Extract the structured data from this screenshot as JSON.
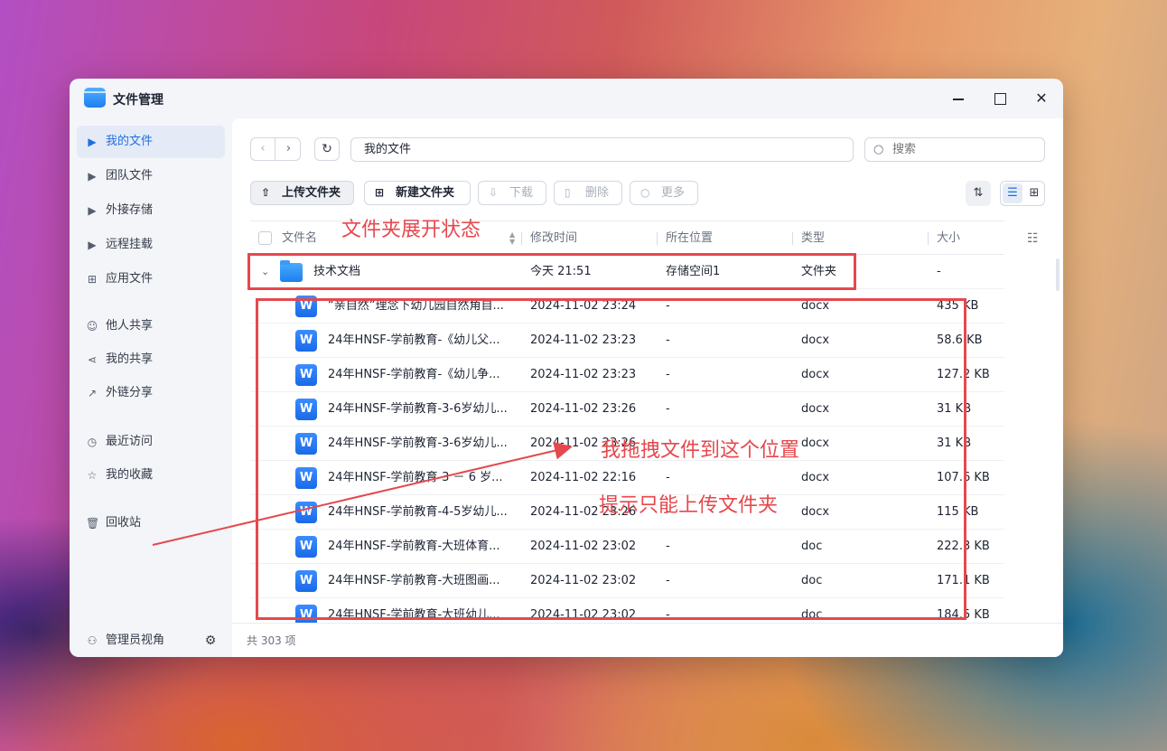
{
  "window": {
    "title": "文件管理"
  },
  "sidebar": {
    "items": [
      {
        "label": "我的文件",
        "icon": "caret-right-icon",
        "active": true
      },
      {
        "label": "团队文件",
        "icon": "caret-right-icon"
      },
      {
        "label": "外接存储",
        "icon": "caret-right-icon"
      },
      {
        "label": "远程挂载",
        "icon": "caret-right-icon"
      },
      {
        "label": "应用文件",
        "icon": "apps-icon"
      },
      {
        "label": "他人共享",
        "icon": "users-icon"
      },
      {
        "label": "我的共享",
        "icon": "share-icon"
      },
      {
        "label": "外链分享",
        "icon": "external-link-icon"
      },
      {
        "label": "最近访问",
        "icon": "clock-icon"
      },
      {
        "label": "我的收藏",
        "icon": "star-icon"
      },
      {
        "label": "回收站",
        "icon": "trash-icon"
      }
    ],
    "footer_label": "管理员视角"
  },
  "toolbar": {
    "path": "我的文件",
    "search_placeholder": "搜索",
    "upload_folder": "上传文件夹",
    "new_folder": "新建文件夹",
    "download": "下载",
    "delete": "删除",
    "more": "更多"
  },
  "table": {
    "headers": {
      "name": "文件名",
      "time": "修改时间",
      "location": "所在位置",
      "type": "类型",
      "size": "大小"
    },
    "folder": {
      "name": "技术文档",
      "time": "今天 21:51",
      "location": "存储空间1",
      "type": "文件夹",
      "size": "-"
    },
    "rows": [
      {
        "name": "“亲自然”理念下幼儿园自然角自...",
        "time": "2024-11-02 23:24",
        "location": "-",
        "type": "docx",
        "size": "435 KB"
      },
      {
        "name": "24年HNSF-学前教育-《幼儿父...",
        "time": "2024-11-02 23:23",
        "location": "-",
        "type": "docx",
        "size": "58.6 KB"
      },
      {
        "name": "24年HNSF-学前教育-《幼儿争...",
        "time": "2024-11-02 23:23",
        "location": "-",
        "type": "docx",
        "size": "127.2 KB"
      },
      {
        "name": "24年HNSF-学前教育-3-6岁幼儿...",
        "time": "2024-11-02 23:26",
        "location": "-",
        "type": "docx",
        "size": "31 KB"
      },
      {
        "name": "24年HNSF-学前教育-3-6岁幼儿...",
        "time": "2024-11-02 23:26",
        "location": "-",
        "type": "docx",
        "size": "31 KB"
      },
      {
        "name": "24年HNSF-学前教育-3 － 6 岁...",
        "time": "2024-11-02 22:16",
        "location": "-",
        "type": "docx",
        "size": "107.6 KB"
      },
      {
        "name": "24年HNSF-学前教育-4-5岁幼儿...",
        "time": "2024-11-02 23:26",
        "location": "-",
        "type": "docx",
        "size": "115 KB"
      },
      {
        "name": "24年HNSF-学前教育-大班体育...",
        "time": "2024-11-02 23:02",
        "location": "-",
        "type": "doc",
        "size": "222.3 KB"
      },
      {
        "name": "24年HNSF-学前教育-大班图画...",
        "time": "2024-11-02 23:02",
        "location": "-",
        "type": "doc",
        "size": "171.1 KB"
      },
      {
        "name": "24年HNSF-学前教育-大班幼儿...",
        "time": "2024-11-02 23:02",
        "location": "-",
        "type": "doc",
        "size": "184.5 KB"
      }
    ],
    "doc_icon_letter": "W"
  },
  "status": {
    "count": "共 303 项"
  },
  "annotations": {
    "folder_expanded": "文件夹展开状态",
    "drag_here": "我拖拽文件到这个位置",
    "hint": "提示只能上传文件夹",
    "color": "#e5484d"
  }
}
